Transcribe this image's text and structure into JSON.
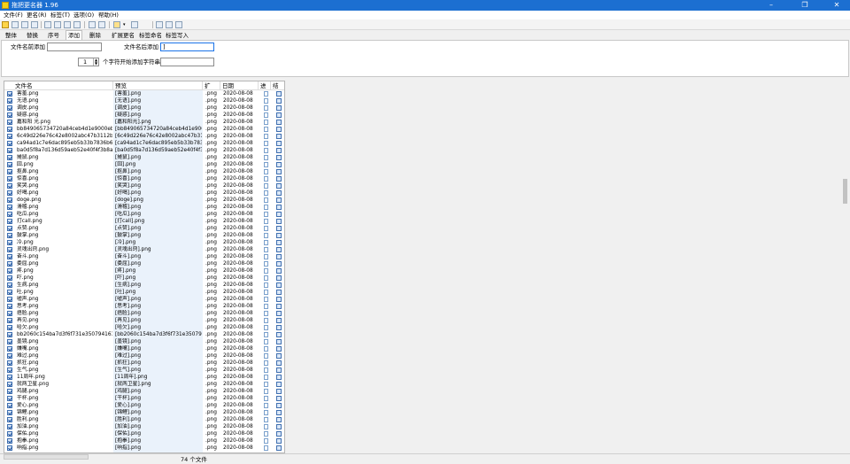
{
  "window": {
    "title": "拖把更名器 1.96",
    "controls": [
      "–",
      "❐",
      "✕"
    ]
  },
  "menu": [
    "文件(F)",
    "更名(R)",
    "标签(T)",
    "选项(O)",
    "帮助(H)"
  ],
  "toolbar_icons": [
    "new-icon",
    "search-icon",
    "refresh-icon",
    "import-icon",
    "export-icon",
    "copy-icon",
    "paste-icon",
    "cut-icon",
    "save-icon",
    "undo-icon",
    "tool-icon",
    "help-icon",
    "options-icon",
    "wrench-icon"
  ],
  "tabs": [
    "整体",
    "替换",
    "序号",
    "添加",
    "删除",
    "扩展更名",
    "标签命名",
    "标签写入"
  ],
  "active_tab": "添加",
  "add_panel": {
    "prefix_label": "文件名前添加",
    "suffix_label": "文件名后添加",
    "suffix_value": "]",
    "spin_value": "1",
    "insert_label": "个字符开始添加字符串"
  },
  "columns": [
    "文件名",
    "预览",
    "扩",
    "日期",
    "进",
    "结"
  ],
  "rows": [
    {
      "name": "害羞.png",
      "preview": "[害羞].png",
      "ext": ".png",
      "date": "2020-08-08"
    },
    {
      "name": "无语.png",
      "preview": "[无语].png",
      "ext": ".png",
      "date": "2020-08-08"
    },
    {
      "name": "调皮.png",
      "preview": "[调皮].png",
      "ext": ".png",
      "date": "2020-08-08"
    },
    {
      "name": "疑惑.png",
      "preview": "[疑惑].png",
      "ext": ".png",
      "date": "2020-08-08"
    },
    {
      "name": "嘉和阳 光.png",
      "preview": "[嘉和阳光].png",
      "ext": ".png",
      "date": "2020-08-08"
    },
    {
      "name": "bb849065734720a84ceb4d1e9000eb...",
      "preview": "[bb849065734720a84ceb4d1e9000...",
      "ext": ".png",
      "date": "2020-08-08"
    },
    {
      "name": "6c49d226e76c42e8002abc47b3112bc...",
      "preview": "[6c49d226e76c42e8002abc47b311...",
      "ext": ".png",
      "date": "2020-08-08"
    },
    {
      "name": "ca94ad1c7e6dac895eb5b33b7836b634...",
      "preview": "[ca94ad1c7e6dac895eb5b33b7836b...",
      "ext": ".png",
      "date": "2020-08-08"
    },
    {
      "name": "ba0d5f8a7d136d59aeb52e40f4f3b8a43...",
      "preview": "[ba0d5f8a7d136d59aeb52e40f4f3b8...",
      "ext": ".png",
      "date": "2020-08-08"
    },
    {
      "name": "摊鼠.png",
      "preview": "[摊鼠].png",
      "ext": ".png",
      "date": "2020-08-08"
    },
    {
      "name": "囧.png",
      "preview": "[囧].png",
      "ext": ".png",
      "date": "2020-08-08"
    },
    {
      "name": "抠鼻.png",
      "preview": "[抠鼻].png",
      "ext": ".png",
      "date": "2020-08-08"
    },
    {
      "name": "惊喜.png",
      "preview": "[惊喜].png",
      "ext": ".png",
      "date": "2020-08-08"
    },
    {
      "name": "笑哭.png",
      "preview": "[笑哭].png",
      "ext": ".png",
      "date": "2020-08-08"
    },
    {
      "name": "好喝.png",
      "preview": "[好喝].png",
      "ext": ".png",
      "date": "2020-08-08"
    },
    {
      "name": "doge.png",
      "preview": "[doge].png",
      "ext": ".png",
      "date": "2020-08-08"
    },
    {
      "name": "滑稽.png",
      "preview": "[滑稽].png",
      "ext": ".png",
      "date": "2020-08-08"
    },
    {
      "name": "吃瓜.png",
      "preview": "[吃瓜].png",
      "ext": ".png",
      "date": "2020-08-08"
    },
    {
      "name": "打call.png",
      "preview": "[打call].png",
      "ext": ".png",
      "date": "2020-08-08"
    },
    {
      "name": "点赞.png",
      "preview": "[点赞].png",
      "ext": ".png",
      "date": "2020-08-08"
    },
    {
      "name": "鼓掌.png",
      "preview": "[鼓掌].png",
      "ext": ".png",
      "date": "2020-08-08"
    },
    {
      "name": "冷.png",
      "preview": "[冷].png",
      "ext": ".png",
      "date": "2020-08-08"
    },
    {
      "name": "灵魂出窍.png",
      "preview": "[灵魂出窍].png",
      "ext": ".png",
      "date": "2020-08-08"
    },
    {
      "name": "奋斗.png",
      "preview": "[奋斗].png",
      "ext": ".png",
      "date": "2020-08-08"
    },
    {
      "name": "委屈.png",
      "preview": "[委屈].png",
      "ext": ".png",
      "date": "2020-08-08"
    },
    {
      "name": "疼.png",
      "preview": "[疼].png",
      "ext": ".png",
      "date": "2020-08-08"
    },
    {
      "name": "吓.png",
      "preview": "[吓].png",
      "ext": ".png",
      "date": "2020-08-08"
    },
    {
      "name": "生病.png",
      "preview": "[生病].png",
      "ext": ".png",
      "date": "2020-08-08"
    },
    {
      "name": "吐.png",
      "preview": "[吐].png",
      "ext": ".png",
      "date": "2020-08-08"
    },
    {
      "name": "嘘声.png",
      "preview": "[嘘声].png",
      "ext": ".png",
      "date": "2020-08-08"
    },
    {
      "name": "思考.png",
      "preview": "[思考].png",
      "ext": ".png",
      "date": "2020-08-08"
    },
    {
      "name": "捂脸.png",
      "preview": "[捂脸].png",
      "ext": ".png",
      "date": "2020-08-08"
    },
    {
      "name": "再见.png",
      "preview": "[再见].png",
      "ext": ".png",
      "date": "2020-08-08"
    },
    {
      "name": "哈欠.png",
      "preview": "[哈欠].png",
      "ext": ".png",
      "date": "2020-08-08"
    },
    {
      "name": "bb2060c154ba7d3f6f731e35079416177...",
      "preview": "[bb2060c154ba7d3f6f731e3507941...",
      "ext": ".png",
      "date": "2020-08-08"
    },
    {
      "name": "墨镜.png",
      "preview": "[墨镜].png",
      "ext": ".png",
      "date": "2020-08-08"
    },
    {
      "name": "嫌嘴.png",
      "preview": "[嫌嘴].png",
      "ext": ".png",
      "date": "2020-08-08"
    },
    {
      "name": "难过.png",
      "preview": "[难过].png",
      "ext": ".png",
      "date": "2020-08-08"
    },
    {
      "name": "抓狂.png",
      "preview": "[抓狂].png",
      "ext": ".png",
      "date": "2020-08-08"
    },
    {
      "name": "生气.png",
      "preview": "[生气].png",
      "ext": ".png",
      "date": "2020-08-08"
    },
    {
      "name": "11周年.png",
      "preview": "[11周年].png",
      "ext": ".png",
      "date": "2020-08-08"
    },
    {
      "name": "就两卫星.png",
      "preview": "[就两卫星].png",
      "ext": ".png",
      "date": "2020-08-08"
    },
    {
      "name": "鸡腿.png",
      "preview": "[鸡腿].png",
      "ext": ".png",
      "date": "2020-08-08"
    },
    {
      "name": "干杯.png",
      "preview": "[干杯].png",
      "ext": ".png",
      "date": "2020-08-08"
    },
    {
      "name": "爱心.png",
      "preview": "[爱心].png",
      "ext": ".png",
      "date": "2020-08-08"
    },
    {
      "name": "锦鲤.png",
      "preview": "[锦鲤].png",
      "ext": ".png",
      "date": "2020-08-08"
    },
    {
      "name": "胜利.png",
      "preview": "[胜利].png",
      "ext": ".png",
      "date": "2020-08-08"
    },
    {
      "name": "加油.png",
      "preview": "[加油].png",
      "ext": ".png",
      "date": "2020-08-08"
    },
    {
      "name": "保佑.png",
      "preview": "[保佑].png",
      "ext": ".png",
      "date": "2020-08-08"
    },
    {
      "name": "抱拳.png",
      "preview": "[抱拳].png",
      "ext": ".png",
      "date": "2020-08-08"
    },
    {
      "name": "响指.png",
      "preview": "[响指].png",
      "ext": ".png",
      "date": "2020-08-08"
    }
  ],
  "status": {
    "file_count": "74 个文件"
  }
}
